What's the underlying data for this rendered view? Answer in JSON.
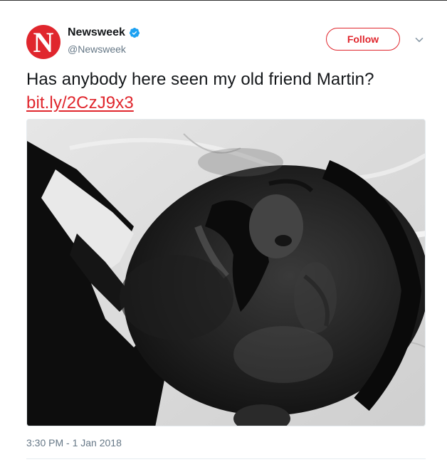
{
  "account": {
    "display_name": "Newsweek",
    "handle": "@Newsweek",
    "avatar_letter": "N",
    "verified": true,
    "brand_color": "#e0262d"
  },
  "actions": {
    "follow_label": "Follow",
    "menu_icon": "chevron-down-icon"
  },
  "tweet": {
    "text": "Has anybody here seen my old friend Martin?",
    "link": "bit.ly/2CzJ9x3",
    "timestamp": "3:30 PM - 1 Jan 2018"
  },
  "colors": {
    "text": "#14171a",
    "secondary_text": "#657786",
    "link": "#e0262d",
    "verified_badge": "#1da1f2"
  }
}
